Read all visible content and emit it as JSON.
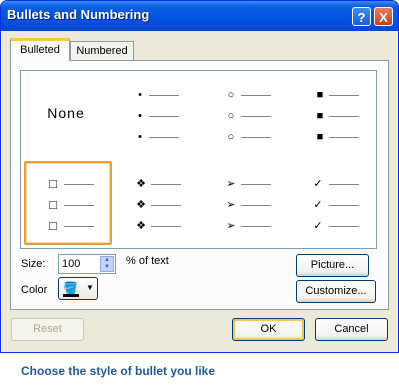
{
  "dialog": {
    "title": "Bullets and Numbering",
    "help_icon": "?",
    "close_icon": "X"
  },
  "tabs": [
    {
      "label": "Bulleted",
      "mnemonic": "B",
      "active": true
    },
    {
      "label": "Numbered",
      "mnemonic": "N",
      "active": false
    }
  ],
  "gallery": {
    "none_label": "None",
    "cells": [
      {
        "id": "none",
        "bullet": ""
      },
      {
        "id": "dot",
        "bullet": "•"
      },
      {
        "id": "circle",
        "bullet": "○"
      },
      {
        "id": "square-filled",
        "bullet": "■"
      },
      {
        "id": "hollow-square",
        "bullet": "□",
        "selected": true
      },
      {
        "id": "four-diamond",
        "bullet": "❖"
      },
      {
        "id": "arrowhead",
        "bullet": "➢"
      },
      {
        "id": "checkmark",
        "bullet": "✓"
      }
    ]
  },
  "size": {
    "label": "Size:",
    "mnemonic": "S",
    "value": "100",
    "suffix": "% of text"
  },
  "color": {
    "label": "Color",
    "mnemonic": "C",
    "swatch": "#000000"
  },
  "buttons": {
    "picture": "Picture...",
    "customize": "Customize...",
    "reset": "Reset",
    "ok": "OK",
    "cancel": "Cancel"
  },
  "caption": "Choose the style of bullet you like",
  "colors": {
    "title_bar": "#0054e3",
    "dialog_bg": "#ece9d8",
    "selection": "#e89d3d",
    "caption": "#1f5a9c"
  }
}
